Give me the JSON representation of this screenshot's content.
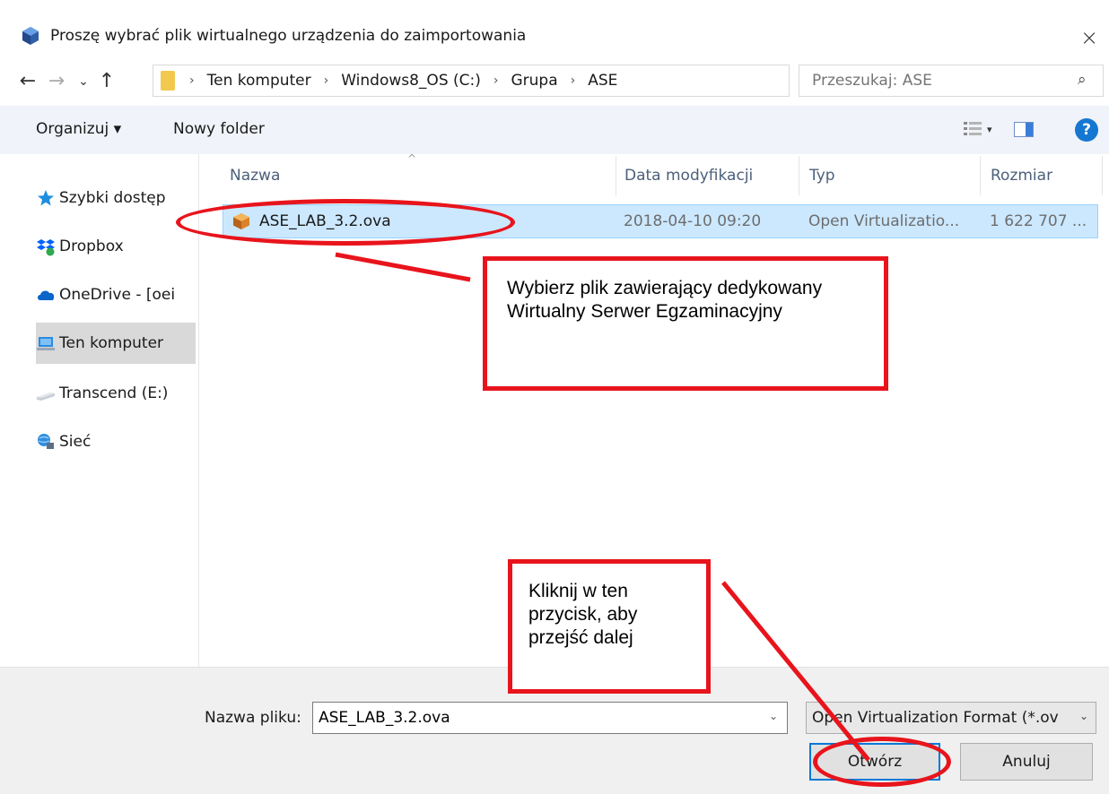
{
  "window": {
    "title": "Proszę wybrać plik wirtualnego urządzenia do zaimportowania",
    "close_label": "×"
  },
  "nav": {
    "back": "←",
    "forward": "→",
    "recent": "⌄",
    "up": "↑"
  },
  "address": {
    "crumbs": [
      "Ten komputer",
      "Windows8_OS (C:)",
      "Grupa",
      "ASE"
    ],
    "separator": "›",
    "dropdown": "⌄",
    "refresh": "↻"
  },
  "search": {
    "placeholder": "Przeszukaj: ASE",
    "icon": "⌕"
  },
  "toolbar": {
    "organize_label": "Organizuj ▾",
    "new_folder_label": "Nowy folder",
    "view_caret": "▾",
    "help_label": "?"
  },
  "sidebar": {
    "items": [
      {
        "label": "Szybki dostęp",
        "icon": "star-icon"
      },
      {
        "label": "Dropbox",
        "icon": "dropbox-icon"
      },
      {
        "label": "OneDrive - [oei",
        "icon": "cloud-icon"
      },
      {
        "label": "Ten komputer",
        "icon": "computer-icon"
      },
      {
        "label": "Transcend (E:)",
        "icon": "drive-icon"
      },
      {
        "label": "Sieć",
        "icon": "network-icon"
      }
    ]
  },
  "filelist": {
    "columns": [
      "Nazwa",
      "Data modyfikacji",
      "Typ",
      "Rozmiar"
    ],
    "sort_caret": "^",
    "rows": [
      {
        "name": "ASE_LAB_3.2.ova",
        "date": "2018-04-10 09:20",
        "type": "Open Virtualizatio...",
        "size": "1 622 707 ..."
      }
    ]
  },
  "bottom": {
    "filename_label": "Nazwa pliku:",
    "filename_value": "ASE_LAB_3.2.ova",
    "filename_caret": "⌄",
    "filter_value": "Open Virtualization Format (*.ov",
    "filter_caret": "⌄",
    "open_label": "Otwórz",
    "cancel_label": "Anuluj"
  },
  "annotations": {
    "select_file": "Wybierz plik zawierający dedykowany Wirtualny Serwer Egzaminacyjny",
    "click_button": "Kliknij w ten przycisk, aby przejść dalej",
    "color": "#e8141c"
  }
}
